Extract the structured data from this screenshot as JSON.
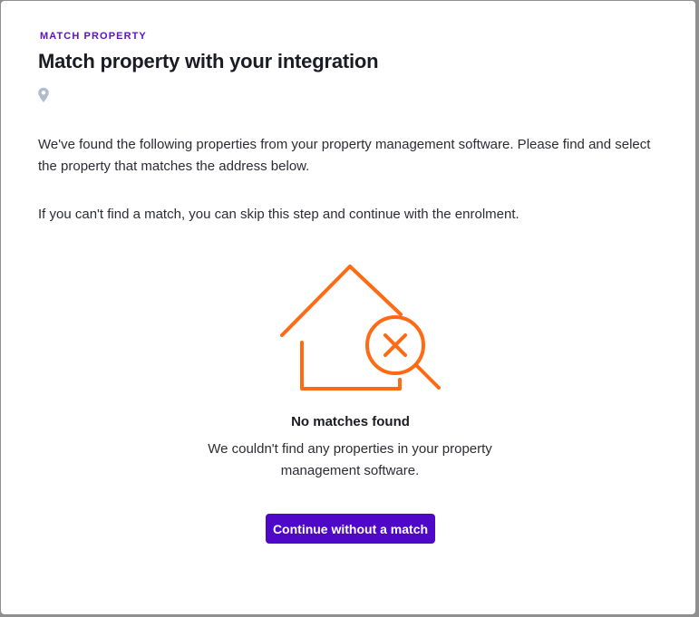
{
  "modal": {
    "eyebrow": "MATCH PROPERTY",
    "title": "Match property with your integration",
    "location_icon": "map-pin-icon",
    "address": "",
    "intro_text": "We've found the following properties from your property management software. Please find and select the property that matches the address below.",
    "skip_text": "If you can't find a match, you can skip this step and continue with the enrolment."
  },
  "empty_state": {
    "illustration_icon": "house-search-no-results-icon",
    "title": "No matches found",
    "description": "We couldn't find any properties in your property management software."
  },
  "actions": {
    "continue_label": "Continue without a match"
  },
  "colors": {
    "accent": "#5008c8",
    "eyebrow": "#5b12c4",
    "illustration": "#ff6a13",
    "pin": "#b3bccb"
  }
}
